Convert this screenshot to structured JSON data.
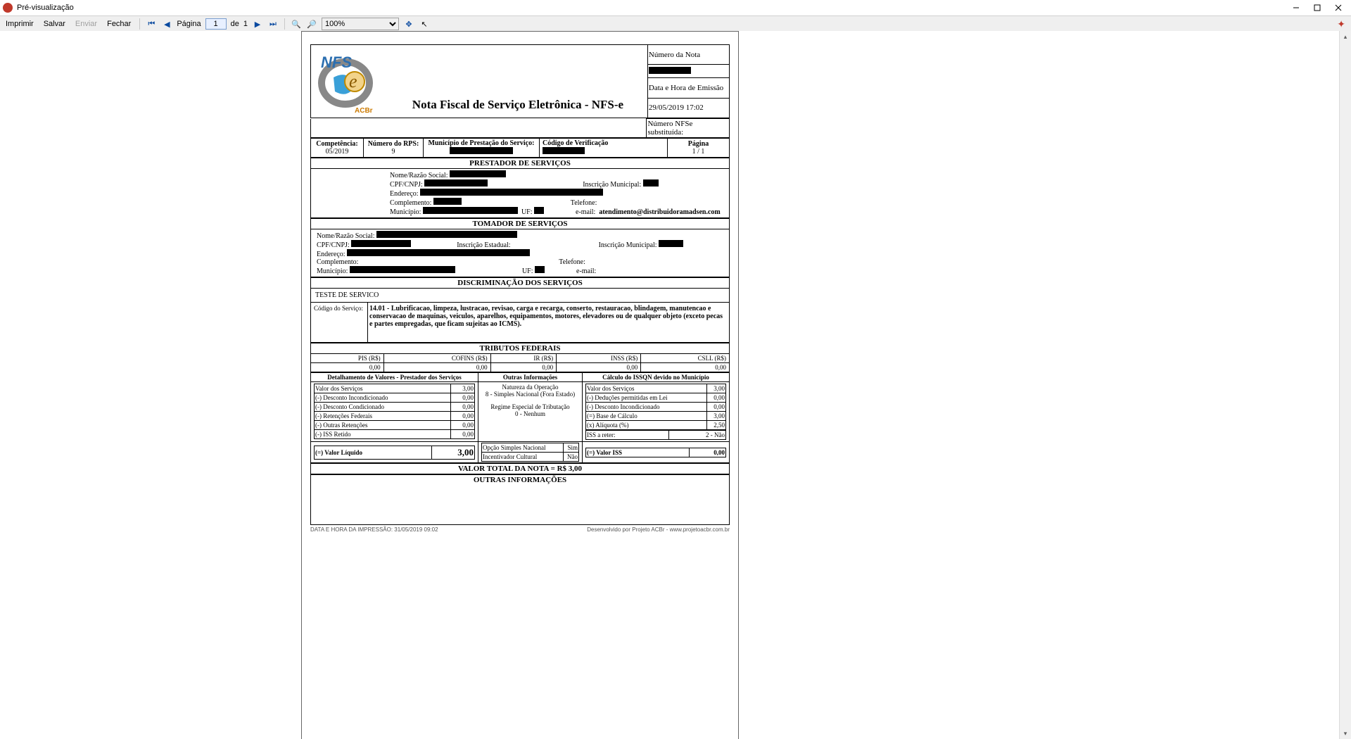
{
  "window": {
    "title": "Pré-visualização"
  },
  "toolbar": {
    "print": "Imprimir",
    "save": "Salvar",
    "send": "Enviar",
    "close": "Fechar",
    "page_label": "Página",
    "page_current": "1",
    "of": "de",
    "page_total": "1",
    "zoom": "100%"
  },
  "nota": {
    "title": "Nota Fiscal de Serviço Eletrônica - NFS-e",
    "numero_label": "Número da Nota",
    "data_label": "Data e Hora de Emissão",
    "data_value": "29/05/2019 17:02",
    "subst_label": "Número NFSe substituída:",
    "competencia_label": "Competência:",
    "competencia": "05/2019",
    "rps_label": "Número do RPS:",
    "rps": "9",
    "municipio_label": "Município de Prestação do Serviço:",
    "codver_label": "Código de Verificação",
    "pagina_label": "Página",
    "pagina_value": "1  /  1"
  },
  "prestador": {
    "title": "PRESTADOR DE SERVIÇOS",
    "razao_lbl": "Nome/Razão Social:",
    "cpf_lbl": "CPF/CNPJ:",
    "im_lbl": "Inscrição Municipal:",
    "end_lbl": "Endereço:",
    "compl_lbl": "Complemento:",
    "tel_lbl": "Telefone:",
    "mun_lbl": "Município:",
    "uf_lbl": "UF:",
    "email_lbl": "e-mail:",
    "email": "atendimento@distribuidoramadsen.com"
  },
  "tomador": {
    "title": "TOMADOR DE SERVIÇOS",
    "razao_lbl": "Nome/Razão Social:",
    "cpf_lbl": "CPF/CNPJ:",
    "ie_lbl": "Inscrição Estadual:",
    "im_lbl": "Inscrição Municipal:",
    "end_lbl": "Endereço:",
    "compl_lbl": "Complemento:",
    "tel_lbl": "Telefone:",
    "mun_lbl": "Município:",
    "uf_lbl": "UF:",
    "email_lbl": "e-mail:"
  },
  "discrim": {
    "title": "DISCRIMINAÇÃO DOS SERVIÇOS",
    "teste": "TESTE DE SERVICO",
    "cod_lbl": "Código do Serviço:",
    "cod_txt": "14.01 - Lubrificacao, limpeza, lustracao, revisao, carga e recarga, conserto, restauracao, blindagem, manutencao e conservacao de maquinas, veiculos, aparelhos, equipamentos, motores, elevadores ou de qualquer objeto (exceto pecas e partes empregadas, que ficam sujeitas ao ICMS)."
  },
  "tributos": {
    "title": "TRIBUTOS FEDERAIS",
    "pis_lbl": "PIS (R$)",
    "pis": "0,00",
    "cofins_lbl": "COFINS (R$)",
    "cofins": "0,00",
    "ir_lbl": "IR (R$)",
    "ir": "0,00",
    "inss_lbl": "INSS (R$)",
    "inss": "0,00",
    "csll_lbl": "CSLL (R$)",
    "csll": "0,00"
  },
  "detalhe": {
    "col1_title": "Detalhamento de Valores - Prestador dos Serviços",
    "col2_title": "Outras Informações",
    "col3_title": "Cálculo do ISSQN devido no Município",
    "c1": [
      [
        "Valor dos Serviços",
        "3,00"
      ],
      [
        "(-) Desconto Incondicionado",
        "0,00"
      ],
      [
        "(-) Desconto Condicionado",
        "0,00"
      ],
      [
        "(-) Retenções Federais",
        "0,00"
      ],
      [
        "(-) Outras Retenções",
        "0,00"
      ],
      [
        "(-) ISS Retido",
        "0,00"
      ]
    ],
    "c1_total_lbl": "(=) Valor Líquido",
    "c1_total": "3,00",
    "c2_nat_lbl": "Natureza da Operação",
    "c2_nat": "8 - Simples Nacional (Fora Estado)",
    "c2_reg_lbl": "Regime Especial de Tributação",
    "c2_reg": "0 - Nenhum",
    "c2_opc_lbl": "Opção Simples Nacional",
    "c2_opc": "Sim",
    "c2_inc_lbl": "Incentivador Cultural",
    "c2_inc": "Não",
    "c3": [
      [
        "Valor dos Serviços",
        "3,00"
      ],
      [
        "(-) Deduções permitidas em Lei",
        "0,00"
      ],
      [
        "(-) Desconto Incondicionado",
        "0,00"
      ],
      [
        "(=) Base de Cálculo",
        "3,00"
      ],
      [
        "(x) Alíquota (%)",
        "2,50"
      ]
    ],
    "c3_iss_lbl": "ISS a reter:",
    "c3_iss": "2 - Não",
    "c3_total_lbl": "(=) Valor ISS",
    "c3_total": "0,00"
  },
  "total": {
    "label": "VALOR TOTAL DA NOTA = R$ 3,00"
  },
  "outras": {
    "title": "OUTRAS INFORMAÇÕES"
  },
  "footer": {
    "left": "DATA E HORA DA IMPRESSÃO: 31/05/2019 09:02",
    "right": "Desenvolvido por Projeto ACBr - www.projetoacbr.com.br"
  }
}
